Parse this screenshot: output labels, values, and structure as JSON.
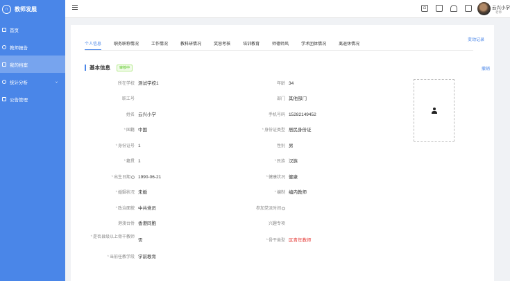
{
  "app": {
    "title": "教师发展",
    "logo_glyph": "∩"
  },
  "sidebar": {
    "items": [
      {
        "label": "首页",
        "icon": "home-icon"
      },
      {
        "label": "教师报告",
        "icon": "report-icon"
      },
      {
        "label": "我的档案",
        "icon": "archive-icon",
        "active": true
      },
      {
        "label": "统计分析",
        "icon": "chart-icon",
        "expandable": true
      },
      {
        "label": "公告管理",
        "icon": "notice-icon"
      }
    ]
  },
  "header": {
    "user": {
      "name": "云兴小学",
      "role": "老师"
    },
    "icons": [
      "fullscreen-icon",
      "shirt-icon",
      "bell-icon",
      "card-icon"
    ]
  },
  "tabs": [
    "个人信息",
    "职务职称情况",
    "工作情况",
    "教科研情况",
    "奖惩考核",
    "培训教育",
    "师德师风",
    "学术团体情况",
    "离退休情况"
  ],
  "links": {
    "change_record": "变动记录",
    "cancel": "撤销"
  },
  "section": {
    "title": "基本信息",
    "status": "审核中"
  },
  "fields": {
    "left": [
      {
        "label": "所在学校",
        "value": "测试学校1"
      },
      {
        "label": "职工号",
        "value": ""
      },
      {
        "label": "姓名",
        "value": "云兴小学"
      },
      {
        "label": "国籍",
        "value": "中国",
        "required": true
      },
      {
        "label": "身份证号",
        "value": "1",
        "required": true
      },
      {
        "label": "籍贯",
        "value": "1",
        "required": true
      },
      {
        "label": "出生日期",
        "value": "1990-06-21",
        "required": true,
        "info": true
      },
      {
        "label": "婚姻状况",
        "value": "未婚",
        "required": true
      },
      {
        "label": "政治面貌",
        "value": "中共党员",
        "required": true
      },
      {
        "label": "港澳台侨",
        "value": "香港同胞"
      },
      {
        "label": "是否县级以上骨干教师",
        "value": "否",
        "required": true
      },
      {
        "label": "当前任教学段",
        "value": "学前教育",
        "required": true
      }
    ],
    "right": [
      {
        "label": "年龄",
        "value": "34"
      },
      {
        "label": "部门",
        "value": "其他部门"
      },
      {
        "label": "手机号码",
        "value": "15282149452"
      },
      {
        "label": "身份证类型",
        "value": "居民身份证",
        "required": true
      },
      {
        "label": "性别",
        "value": "男"
      },
      {
        "label": "民族",
        "value": "汉族",
        "required": true
      },
      {
        "label": "健康状况",
        "value": "健康",
        "required": true
      },
      {
        "label": "编制",
        "value": "编内教师",
        "required": true
      },
      {
        "label": "参加党派时间",
        "value": "",
        "info": true
      },
      {
        "label": "兴趣专项",
        "value": ""
      },
      {
        "label": "骨干类型",
        "value": "区青年教师",
        "required": true,
        "red": true
      }
    ]
  },
  "colors": {
    "primary": "#4a86e8",
    "status_green": "#52c41a",
    "value_red": "#e53935"
  }
}
